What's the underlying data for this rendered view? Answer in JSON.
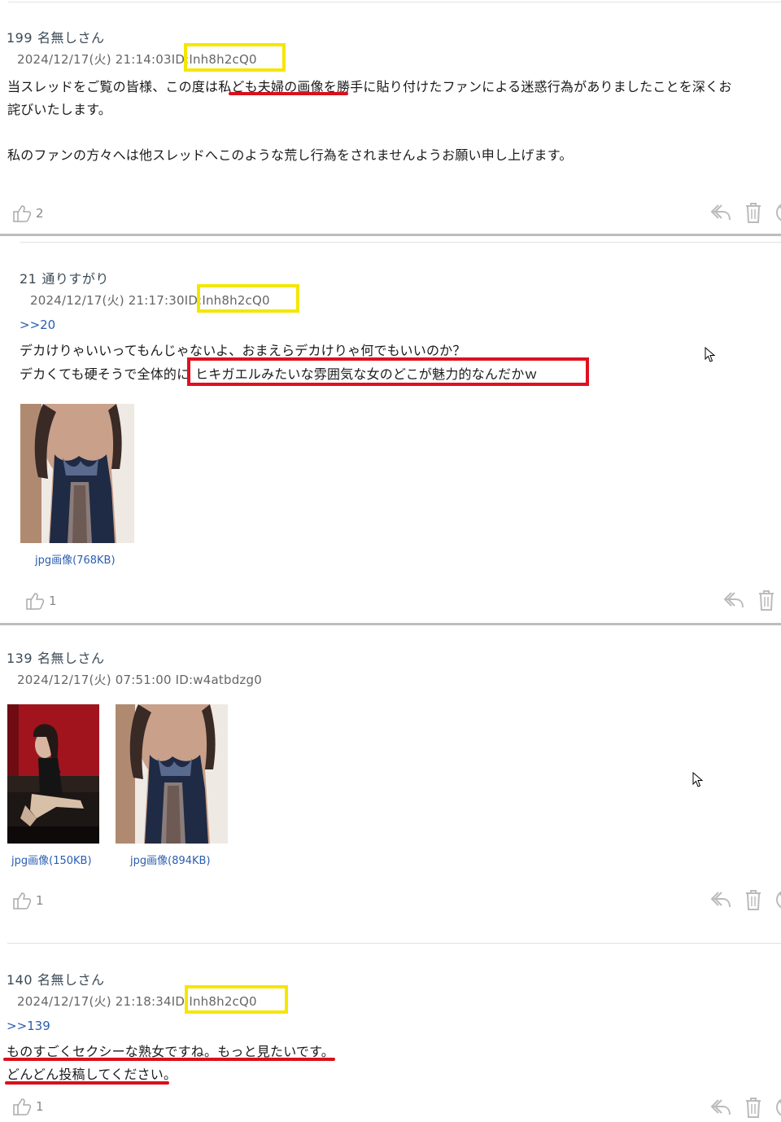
{
  "posts": [
    {
      "num": "199",
      "name": "名無しさん",
      "date": "2024/12/17(火) 21:14:03",
      "id": "ID:Inh8h2cQ0",
      "lines": [
        "当スレッドをご覧の皆様、この度は私ども夫婦の画像を勝手に貼り付けたファンによる迷惑行為がありましたことを深くお",
        "詫びいたします。",
        "私のファンの方々へは他スレッドへこのような荒し行為をされませんようお願い申し上げます。"
      ],
      "likes": "2"
    },
    {
      "num": "21",
      "name": "通りすがり",
      "date": "2024/12/17(火) 21:17:30",
      "id": "ID:Inh8h2cQ0",
      "anchor": ">>20",
      "lines": [
        "デカけりゃいいってもんじゃないよ、おまえらデカけりゃ何でもいいのか？",
        "デカくても硬そうで全体的に",
        "ヒキガエルみたいな雰囲気な女のどこが魅力的なんだかｗ"
      ],
      "images": [
        {
          "caption": "jpg画像(768KB)"
        }
      ],
      "likes": "1"
    },
    {
      "num": "139",
      "name": "名無しさん",
      "date": "2024/12/17(火) 07:51:00",
      "id": "ID:w4atbdzg0",
      "images": [
        {
          "caption": "jpg画像(150KB)"
        },
        {
          "caption": "jpg画像(894KB)"
        }
      ],
      "likes": "1"
    },
    {
      "num": "140",
      "name": "名無しさん",
      "date": "2024/12/17(火) 21:18:34",
      "id": "ID:Inh8h2cQ0",
      "anchor": ">>139",
      "lines": [
        "ものすごくセクシーな熟女ですね。もっと見たいです。",
        "どんどん投稿してください。"
      ],
      "likes": "1"
    }
  ],
  "icons": {
    "like": "thumbs-up-icon",
    "reply": "reply-icon",
    "delete": "trash-icon",
    "block": "block-icon",
    "cursor": "mouse-cursor-icon"
  },
  "colors": {
    "highlight_yellow": "#f5e600",
    "highlight_red": "#e01020",
    "link": "#2a5db0"
  }
}
